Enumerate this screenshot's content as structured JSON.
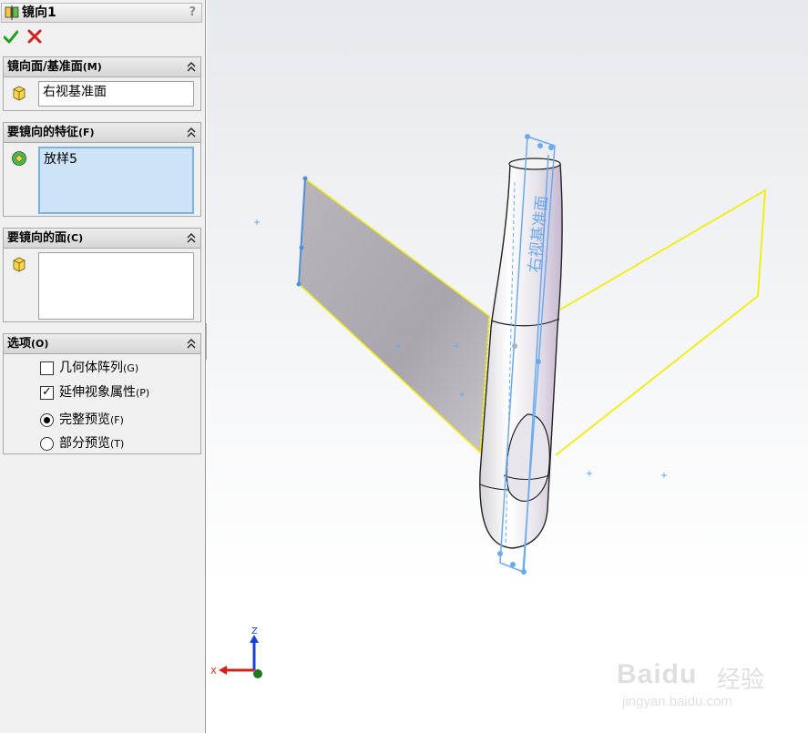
{
  "panel": {
    "title": "镜向1",
    "help": "?"
  },
  "groups": {
    "mirror_plane": {
      "title": "镜向面/基准面",
      "key": "(M)",
      "value": "右视基准面"
    },
    "features": {
      "title": "要镜向的特征",
      "key": "(F)",
      "items": [
        "放样5"
      ]
    },
    "faces": {
      "title": "要镜向的面",
      "key": "(C)"
    },
    "options": {
      "title": "选项",
      "key": "(O)",
      "geometry_pattern": {
        "label": "几何体阵列",
        "key": "(G)",
        "checked": false
      },
      "propagate_visual": {
        "label": "延伸视象属性",
        "key": "(P)",
        "checked": true
      },
      "full_preview": {
        "label": "完整预览",
        "key": "(F)",
        "selected": true
      },
      "partial_preview": {
        "label": "部分预览",
        "key": "(T)",
        "selected": false
      }
    }
  },
  "viewport": {
    "plane_label": "右视基准面",
    "triad": {
      "z": "Z",
      "x": "X"
    },
    "watermark": {
      "brand": "Baidu",
      "suffix": "经验",
      "url": "jingyan.baidu.com"
    }
  },
  "colors": {
    "preview_outline": "#f2ee1e",
    "plane_blue": "#6aaaf0",
    "panel_bg": "#f0f0f0",
    "active_list": "#cde3f7"
  }
}
